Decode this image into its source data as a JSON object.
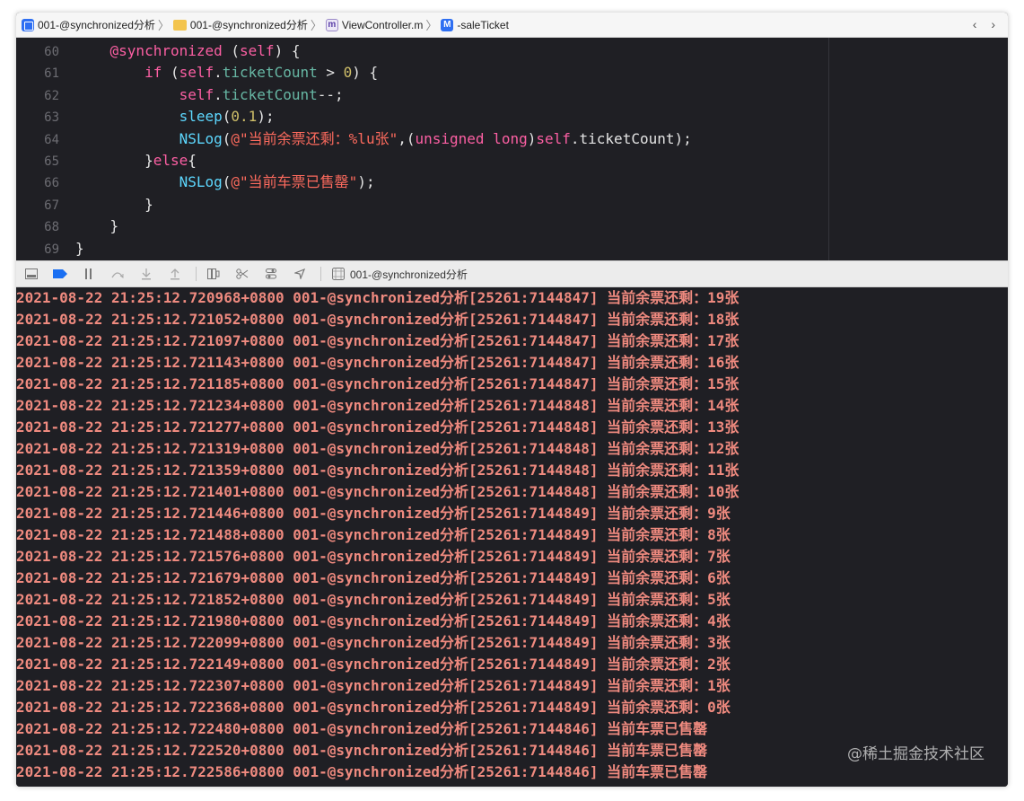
{
  "jumpbar": {
    "crumbs": [
      {
        "label": "001-@synchronized分析",
        "icon": "project-icon"
      },
      {
        "label": "001-@synchronized分析",
        "icon": "folder-icon"
      },
      {
        "label": "ViewController.m",
        "icon": "objc-file-icon",
        "icon_glyph": "m"
      },
      {
        "label": "-saleTicket",
        "icon": "method-icon",
        "icon_glyph": "M"
      }
    ],
    "nav": "‹ ›"
  },
  "editor": {
    "lines": [
      {
        "n": "60",
        "tokens": [
          [
            "    ",
            "plain"
          ],
          [
            "@synchronized",
            "kw"
          ],
          [
            " (",
            "plain"
          ],
          [
            "self",
            "slf"
          ],
          [
            ") {",
            "plain"
          ]
        ]
      },
      {
        "n": "61",
        "tokens": [
          [
            "        ",
            "plain"
          ],
          [
            "if",
            "kw"
          ],
          [
            " (",
            "plain"
          ],
          [
            "self",
            "slf"
          ],
          [
            ".",
            "plain"
          ],
          [
            "ticketCount",
            "prop"
          ],
          [
            " > ",
            "plain"
          ],
          [
            "0",
            "num"
          ],
          [
            ") {",
            "plain"
          ]
        ]
      },
      {
        "n": "62",
        "tokens": [
          [
            "            ",
            "plain"
          ],
          [
            "self",
            "slf"
          ],
          [
            ".",
            "plain"
          ],
          [
            "ticketCount",
            "prop"
          ],
          [
            "--;",
            "plain"
          ]
        ]
      },
      {
        "n": "63",
        "tokens": [
          [
            "            ",
            "plain"
          ],
          [
            "sleep",
            "fn"
          ],
          [
            "(",
            "plain"
          ],
          [
            "0.1",
            "num"
          ],
          [
            ");",
            "plain"
          ]
        ]
      },
      {
        "n": "64",
        "tokens": [
          [
            "            ",
            "plain"
          ],
          [
            "NSLog",
            "fn"
          ],
          [
            "(",
            "plain"
          ],
          [
            "@\"当前余票还剩：%lu张\"",
            "str"
          ],
          [
            ",(",
            "plain"
          ],
          [
            "unsigned long",
            "kw"
          ],
          [
            ")",
            "plain"
          ],
          [
            "self",
            "slf"
          ],
          [
            ".ticketCount);",
            "plain"
          ]
        ]
      },
      {
        "n": "65",
        "tokens": [
          [
            "        }",
            "plain"
          ],
          [
            "else",
            "kw"
          ],
          [
            "{",
            "plain"
          ]
        ]
      },
      {
        "n": "66",
        "tokens": [
          [
            "            ",
            "plain"
          ],
          [
            "NSLog",
            "fn"
          ],
          [
            "(",
            "plain"
          ],
          [
            "@\"当前车票已售罄\"",
            "str"
          ],
          [
            ");",
            "plain"
          ]
        ]
      },
      {
        "n": "67",
        "tokens": [
          [
            "        }",
            "plain"
          ]
        ]
      },
      {
        "n": "68",
        "tokens": [
          [
            "    }",
            "plain"
          ]
        ]
      },
      {
        "n": "69",
        "tokens": [
          [
            "}",
            "plain"
          ]
        ]
      }
    ]
  },
  "debugbar": {
    "target_label": "001-@synchronized分析"
  },
  "console": {
    "lines": [
      "2021-08-22 21:25:12.720968+0800 001-@synchronized分析[25261:7144847] 当前余票还剩：19张",
      "2021-08-22 21:25:12.721052+0800 001-@synchronized分析[25261:7144847] 当前余票还剩：18张",
      "2021-08-22 21:25:12.721097+0800 001-@synchronized分析[25261:7144847] 当前余票还剩：17张",
      "2021-08-22 21:25:12.721143+0800 001-@synchronized分析[25261:7144847] 当前余票还剩：16张",
      "2021-08-22 21:25:12.721185+0800 001-@synchronized分析[25261:7144847] 当前余票还剩：15张",
      "2021-08-22 21:25:12.721234+0800 001-@synchronized分析[25261:7144848] 当前余票还剩：14张",
      "2021-08-22 21:25:12.721277+0800 001-@synchronized分析[25261:7144848] 当前余票还剩：13张",
      "2021-08-22 21:25:12.721319+0800 001-@synchronized分析[25261:7144848] 当前余票还剩：12张",
      "2021-08-22 21:25:12.721359+0800 001-@synchronized分析[25261:7144848] 当前余票还剩：11张",
      "2021-08-22 21:25:12.721401+0800 001-@synchronized分析[25261:7144848] 当前余票还剩：10张",
      "2021-08-22 21:25:12.721446+0800 001-@synchronized分析[25261:7144849] 当前余票还剩：9张",
      "2021-08-22 21:25:12.721488+0800 001-@synchronized分析[25261:7144849] 当前余票还剩：8张",
      "2021-08-22 21:25:12.721576+0800 001-@synchronized分析[25261:7144849] 当前余票还剩：7张",
      "2021-08-22 21:25:12.721679+0800 001-@synchronized分析[25261:7144849] 当前余票还剩：6张",
      "2021-08-22 21:25:12.721852+0800 001-@synchronized分析[25261:7144849] 当前余票还剩：5张",
      "2021-08-22 21:25:12.721980+0800 001-@synchronized分析[25261:7144849] 当前余票还剩：4张",
      "2021-08-22 21:25:12.722099+0800 001-@synchronized分析[25261:7144849] 当前余票还剩：3张",
      "2021-08-22 21:25:12.722149+0800 001-@synchronized分析[25261:7144849] 当前余票还剩：2张",
      "2021-08-22 21:25:12.722307+0800 001-@synchronized分析[25261:7144849] 当前余票还剩：1张",
      "2021-08-22 21:25:12.722368+0800 001-@synchronized分析[25261:7144849] 当前余票还剩：0张",
      "2021-08-22 21:25:12.722480+0800 001-@synchronized分析[25261:7144846] 当前车票已售罄",
      "2021-08-22 21:25:12.722520+0800 001-@synchronized分析[25261:7144846] 当前车票已售罄",
      "2021-08-22 21:25:12.722586+0800 001-@synchronized分析[25261:7144846] 当前车票已售罄"
    ]
  },
  "watermark": "@稀土掘金技术社区",
  "colors": {
    "editor_bg": "#1f1f24",
    "keyword": "#fc5fa3",
    "property": "#67b7a4",
    "number": "#d0bf69",
    "function": "#5dd8ff",
    "string": "#fc6a5d",
    "console_text": "#ef8a7f"
  }
}
